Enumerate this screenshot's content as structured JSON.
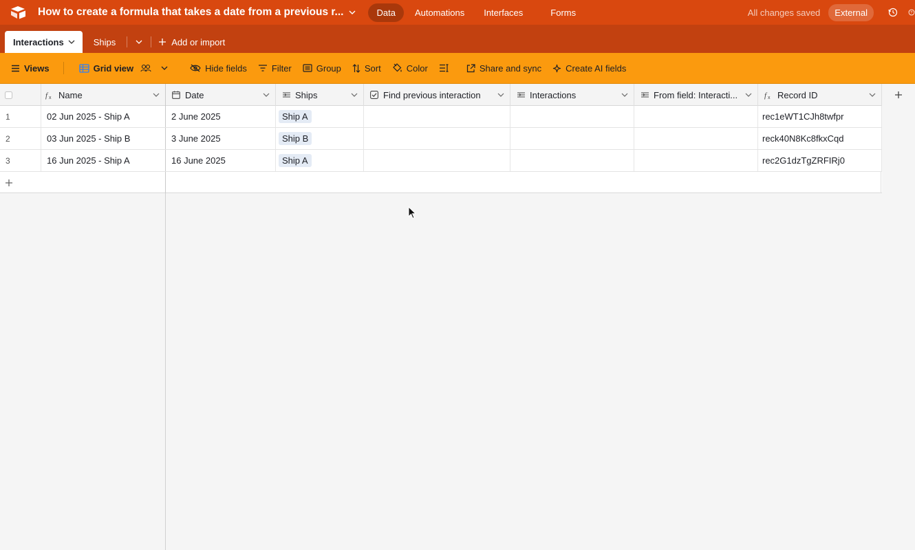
{
  "app": {
    "base_title": "How to create a formula that takes a date from a previous r...",
    "nav": [
      {
        "label": "Data",
        "active": true
      },
      {
        "label": "Automations",
        "active": false
      },
      {
        "label": "Interfaces",
        "active": false
      },
      {
        "label": "Forms",
        "active": false
      }
    ],
    "status": "All changes saved",
    "external_label": "External",
    "icons": [
      "airtable-logo-icon",
      "chevron-down-icon",
      "history-icon",
      "help-icon"
    ]
  },
  "tables": {
    "tabs": [
      {
        "label": "Interactions",
        "active": true
      },
      {
        "label": "Ships",
        "active": false
      }
    ],
    "add_import": "Add or import"
  },
  "toolbar": {
    "views": "Views",
    "grid_view": "Grid view",
    "hide_fields": "Hide fields",
    "filter": "Filter",
    "group": "Group",
    "sort": "Sort",
    "color": "Color",
    "share_sync": "Share and sync",
    "create_ai_fields": "Create AI fields"
  },
  "grid": {
    "columns": [
      {
        "label": "Name",
        "icon": "formula-icon"
      },
      {
        "label": "Date",
        "icon": "calendar-icon"
      },
      {
        "label": "Ships",
        "icon": "link-icon"
      },
      {
        "label": "Find previous interaction",
        "icon": "checkbox-icon"
      },
      {
        "label": "Interactions",
        "icon": "link-icon"
      },
      {
        "label": "From field: Interacti...",
        "icon": "link-icon"
      },
      {
        "label": "Record ID",
        "icon": "formula-icon"
      }
    ],
    "rows": [
      {
        "num": "1",
        "name": "02 Jun 2025 - Ship A",
        "date": "2 June 2025",
        "ships": "Ship A",
        "find_prev": "",
        "interactions": "",
        "from_field": "",
        "record_id": "rec1eWT1CJh8twfpr"
      },
      {
        "num": "2",
        "name": "03 Jun 2025 - Ship B",
        "date": "3 June 2025",
        "ships": "Ship B",
        "find_prev": "",
        "interactions": "",
        "from_field": "",
        "record_id": "reck40N8Kc8fkxCqd"
      },
      {
        "num": "3",
        "name": "16 Jun 2025 - Ship A",
        "date": "16 June 2025",
        "ships": "Ship A",
        "find_prev": "",
        "interactions": "",
        "from_field": "",
        "record_id": "rec2G1dzTgZRFIRj0"
      }
    ]
  },
  "colors": {
    "topbar": "#d9480f",
    "tabbar": "#c24110",
    "toolbar": "#fb9a0e",
    "chip": "#e4ebf5"
  }
}
